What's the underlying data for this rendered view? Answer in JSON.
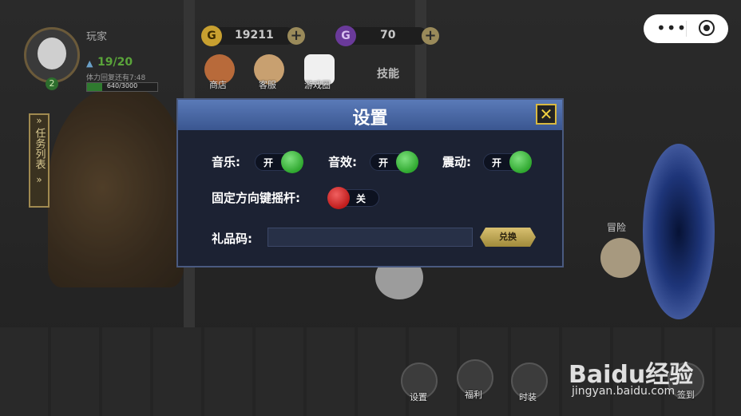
{
  "player": {
    "name": "玩家",
    "level": "2",
    "stamina": "19/20",
    "stamina_note": "体力回复还有7:48",
    "exp_text": "640/3000",
    "exp_fraction": 0.213
  },
  "resources": {
    "gold_icon": "G",
    "gold": "19211",
    "gem_icon": "G",
    "gems": "70",
    "plus": "+"
  },
  "top_menu": {
    "shop": "商店",
    "service": "客服",
    "game_circle": "游戏圈",
    "skills": "技能"
  },
  "task_list": {
    "chevron": "»",
    "label": "任务列表"
  },
  "adventure": "冒险",
  "bottom_menu": {
    "settings": "设置",
    "welfare": "福利",
    "fashion": "时装",
    "sign_in": "签到"
  },
  "watermark": {
    "main": "Baidu经验",
    "sub": "jingyan.baidu.com"
  },
  "mini_menu": {
    "dots": "•••"
  },
  "dialog": {
    "title": "设置",
    "close": "✕",
    "music_label": "音乐:",
    "music_state": "开",
    "sfx_label": "音效:",
    "sfx_state": "开",
    "vibrate_label": "震动:",
    "vibrate_state": "开",
    "joystick_label": "固定方向键摇杆:",
    "joystick_state": "关",
    "gift_label": "礼品码:",
    "gift_value": "",
    "redeem": "兑换"
  },
  "colors": {
    "toggle_on": "#2fa82f",
    "toggle_off": "#c01c1c",
    "dialog_header": "#4a66a0",
    "accent_gold": "#d8b840"
  }
}
